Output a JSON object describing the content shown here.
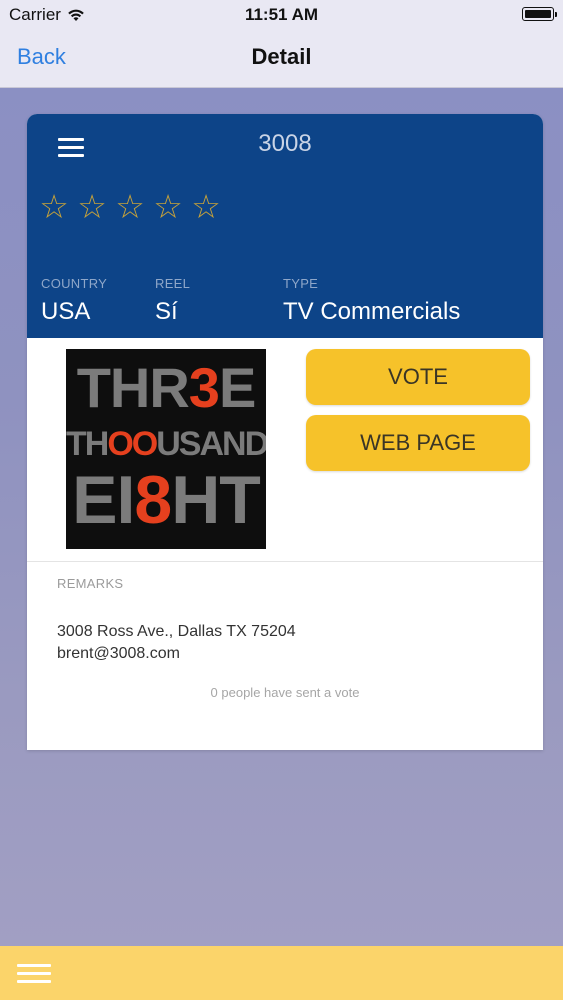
{
  "status_bar": {
    "carrier": "Carrier",
    "time": "11:51 AM"
  },
  "nav": {
    "back_label": "Back",
    "title": "Detail"
  },
  "card": {
    "title": "3008",
    "stars": [
      "☆",
      "☆",
      "☆",
      "☆",
      "☆"
    ],
    "rating": 0,
    "fields": {
      "country": {
        "label": "COUNTRY",
        "value": "USA"
      },
      "reel": {
        "label": "REEL",
        "value": "Sí"
      },
      "type": {
        "label": "TYPE",
        "value": "TV Commercials"
      }
    },
    "logo": {
      "line1_a": "THR",
      "line1_b": "3",
      "line1_c": "E",
      "line2_a": "TH",
      "line2_b": "OO",
      "line2_c": "USAND",
      "line3_a": "EI",
      "line3_b": "8",
      "line3_c": "HT"
    },
    "buttons": {
      "vote": "VOTE",
      "web_page": "WEB PAGE"
    },
    "remarks_label": "REMARKS",
    "remarks": {
      "address": "3008 Ross Ave., Dallas TX 75204",
      "email": "brent@3008.com"
    },
    "votes_text": "0 people have sent a vote"
  },
  "colors": {
    "header_blue": "#0d4488",
    "button_yellow": "#f6c22a",
    "link_blue": "#2f7fe0",
    "logo_red": "#e5401e"
  },
  "icons": {
    "menu": "hamburger-menu-icon",
    "wifi": "wifi-icon",
    "battery": "battery-icon",
    "star": "star-outline-icon"
  }
}
